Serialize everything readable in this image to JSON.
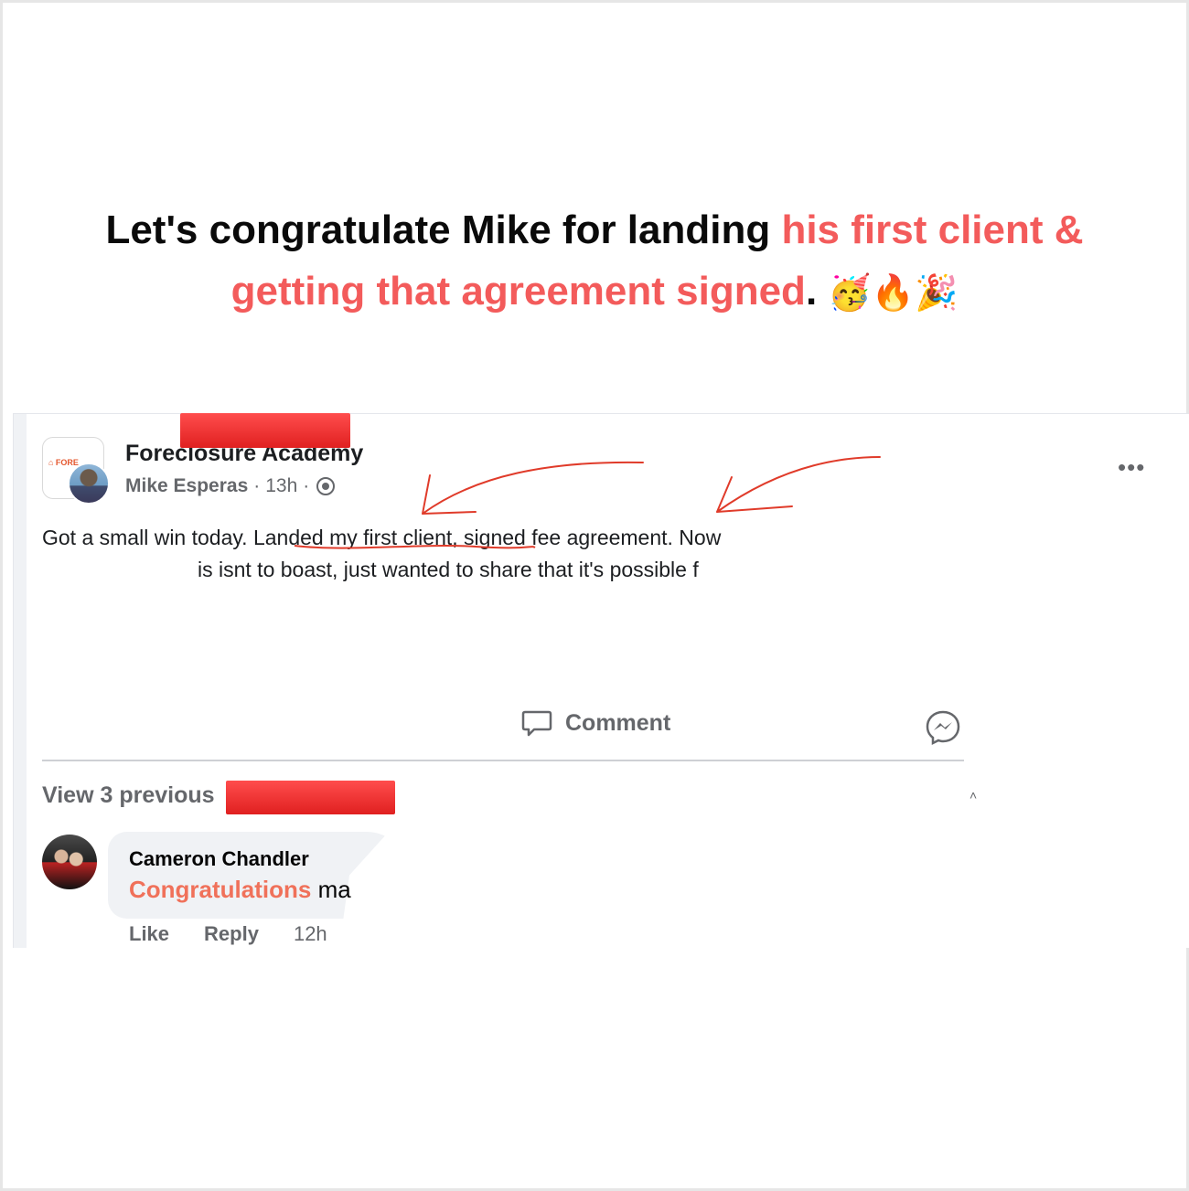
{
  "headline": {
    "part1": "Let's congratulate Mike for landing ",
    "part2": "his first client &",
    "part3": "getting that agreement signed",
    "part4": ".",
    "emojis": "🥳🔥🎉"
  },
  "post": {
    "group_name": "Foreclosure Academy",
    "author": "Mike Esperas",
    "time_sep": "·",
    "time": "13h",
    "time_sep2": "·",
    "audience_icon": "group-audience-icon",
    "more_icon": "•••",
    "line1": "Got a small win today. Landed my first client, signed fee agreement. Now",
    "line2": "is isnt to boast, just wanted to share that it's possible f"
  },
  "actions": {
    "comment_label": "Comment",
    "share_icon": "messenger-icon"
  },
  "comments": {
    "view_previous": "View 3 previous",
    "items": [
      {
        "name": "Cameron Chandler",
        "highlight": "Congratulations",
        "rest": " ma",
        "like": "Like",
        "reply": "Reply",
        "time": "12h"
      }
    ]
  },
  "colors": {
    "accent": "#f35b5b",
    "redaction": "#ff3b3b",
    "annotation": "#e03b2a",
    "comment_highlight": "#f0715a",
    "muted": "#65676b"
  }
}
